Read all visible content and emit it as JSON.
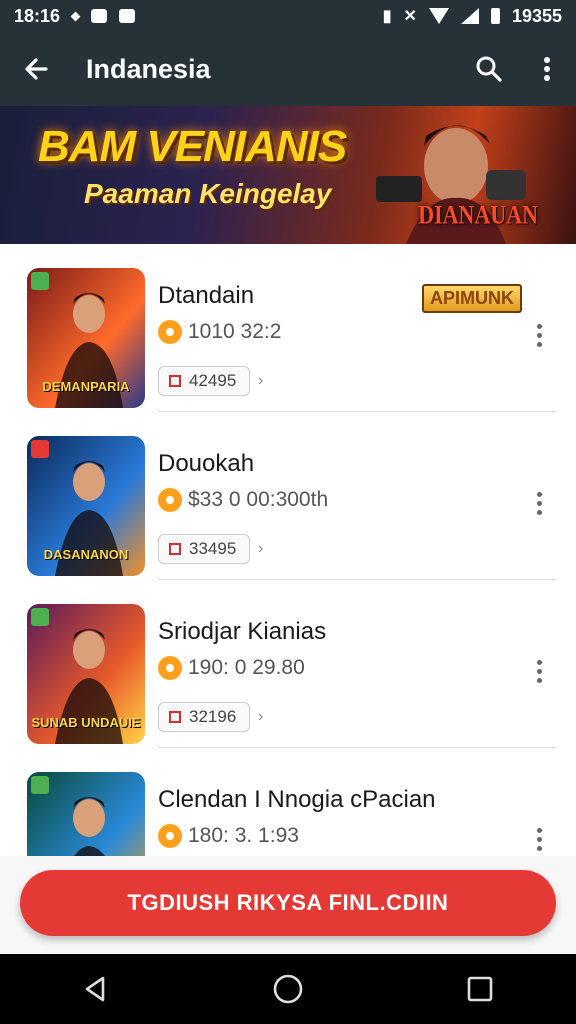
{
  "status_bar": {
    "time_left": "18:16",
    "time_right": "19355"
  },
  "app_bar": {
    "title": "Indanesia"
  },
  "banner": {
    "title": "BAM VENIANIS",
    "subtitle": "Paaman Keingelay",
    "badge": "DIANAUAN"
  },
  "items": [
    {
      "title": "Dtandain",
      "meta": "1010 32:2",
      "chip": "42495",
      "badge": "APIMUNK",
      "thumb_logo": "DEMANPARIA",
      "colors": [
        "#7a1a1a",
        "#ff6a2a",
        "#2a3a8a"
      ]
    },
    {
      "title": "Douokah",
      "meta": "$33 0 00:300th",
      "chip": "33495",
      "thumb_logo": "DASANANON",
      "colors": [
        "#0b2a5a",
        "#2a7ad8",
        "#f0902a"
      ]
    },
    {
      "title": "Sriodjar Kianias",
      "meta": "190: 0 29.80",
      "chip": "32196",
      "thumb_logo": "SUNAB UNDAUIE",
      "colors": [
        "#5a1a5a",
        "#e85a2a",
        "#ffd54a"
      ]
    },
    {
      "title": "Clendan I Nnogia cPacian",
      "meta": "180: 3. 1:93",
      "chip": "",
      "thumb_logo": "",
      "colors": [
        "#0a4a3a",
        "#2a8ad8",
        "#e0a030"
      ]
    }
  ],
  "cta": {
    "label": "TGDIUSH RIKYSA FINL.CDIIN"
  },
  "colors": {
    "appbar": "#263238",
    "accent": "#e53935",
    "coin": "#ff9f1c"
  },
  "icons": [
    "back-arrow-icon",
    "search-icon",
    "more-vert-icon",
    "coin-icon",
    "nav-back-icon",
    "nav-home-icon",
    "nav-recents-icon"
  ]
}
